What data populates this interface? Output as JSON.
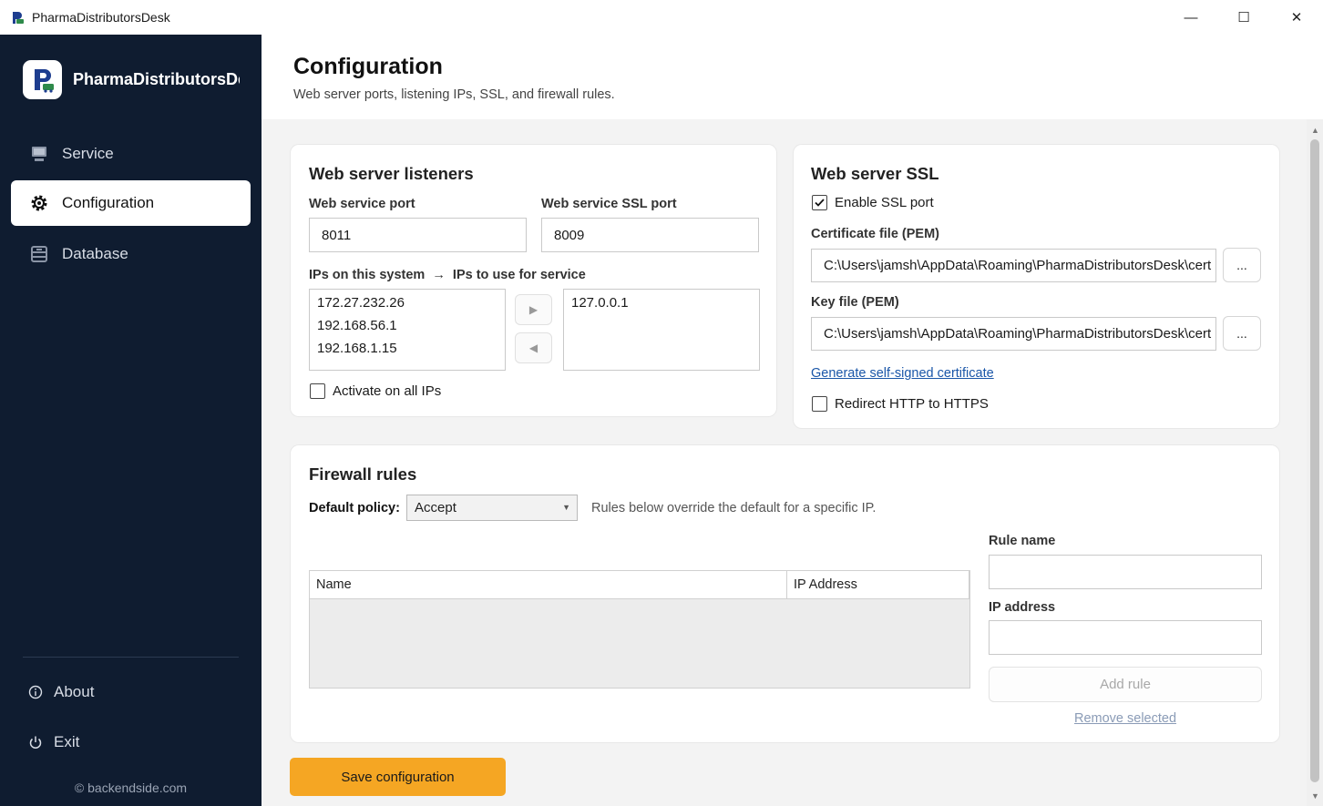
{
  "window": {
    "title": "PharmaDistributorsDesk",
    "minimize_glyph": "—",
    "maximize_glyph": "☐",
    "close_glyph": "✕"
  },
  "sidebar": {
    "brand_name": "PharmaDistributorsDesk",
    "nav": [
      {
        "label": "Service",
        "icon": "monitor-icon",
        "active": false
      },
      {
        "label": "Configuration",
        "icon": "gear-icon",
        "active": true
      },
      {
        "label": "Database",
        "icon": "database-icon",
        "active": false
      }
    ],
    "footer": [
      {
        "label": "About",
        "icon": "info-icon"
      },
      {
        "label": "Exit",
        "icon": "power-icon"
      }
    ],
    "copyright": "© backendside.com"
  },
  "header": {
    "title": "Configuration",
    "subtitle": "Web server ports, listening IPs, SSL, and firewall rules."
  },
  "listeners": {
    "title": "Web server listeners",
    "port_label": "Web service port",
    "port_value": "8011",
    "ssl_port_label": "Web service SSL port",
    "ssl_port_value": "8009",
    "ips_label": "IPs on this system  →  IPs to use for service",
    "available_ips": [
      "172.27.232.26",
      "192.168.56.1",
      "192.168.1.15"
    ],
    "selected_ips": [
      "127.0.0.1"
    ],
    "add_arrow": "▶",
    "remove_arrow": "◀",
    "activate_all_label": "Activate on all IPs",
    "activate_all_checked": false
  },
  "ssl": {
    "title": "Web server SSL",
    "enable_label": "Enable SSL port",
    "enable_checked": true,
    "cert_label": "Certificate file (PEM)",
    "cert_value": "C:\\Users\\jamsh\\AppData\\Roaming\\PharmaDistributorsDesk\\cert",
    "key_label": "Key file (PEM)",
    "key_value": "C:\\Users\\jamsh\\AppData\\Roaming\\PharmaDistributorsDesk\\cert",
    "browse_label": "...",
    "generate_link": "Generate self-signed certificate",
    "redirect_label": "Redirect HTTP to HTTPS",
    "redirect_checked": false
  },
  "firewall": {
    "title": "Firewall rules",
    "policy_label": "Default policy:",
    "policy_value": "Accept",
    "policy_hint": "Rules below override the default for a specific IP.",
    "columns": [
      "Name",
      "IP Address"
    ],
    "rule_name_label": "Rule name",
    "rule_name_value": "",
    "ip_label": "IP address",
    "ip_value": "",
    "add_rule_label": "Add rule",
    "remove_selected_label": "Remove selected"
  },
  "save_label": "Save configuration",
  "colors": {
    "sidebar_bg": "#0f1c30",
    "accent": "#f5a623",
    "link": "#1a56a8"
  }
}
